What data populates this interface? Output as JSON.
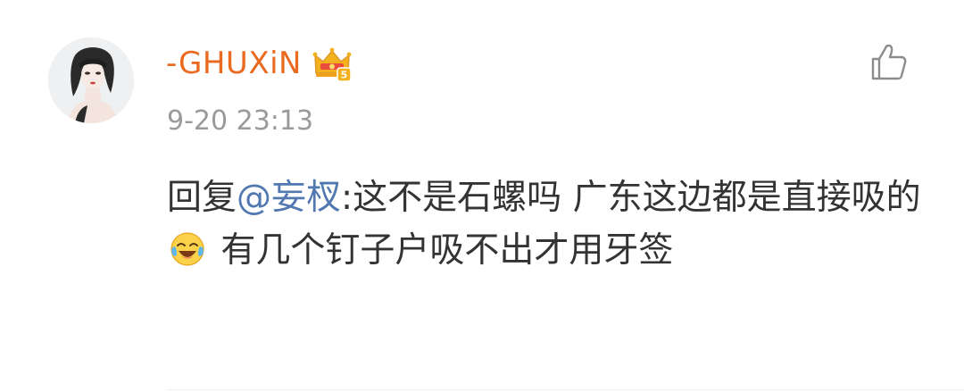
{
  "comment": {
    "username": "-GHUXiN",
    "badge_level": "5",
    "timestamp": "9-20 23:13",
    "content": {
      "reply_prefix": "回复",
      "mention": "@妄杈",
      "text_before_emoji": ":这不是石螺吗 广东这边都是直接吸的",
      "emoji": "laugh-cry-emoji",
      "text_after_emoji": " 有几个钉子户吸不出才用牙签"
    }
  },
  "colors": {
    "username": "#ea6a1f",
    "mention": "#5278b1",
    "body_text": "#333333",
    "timestamp": "#9a9a9a",
    "badge_gold": "#f3b21d",
    "badge_red": "#e94b3c"
  },
  "icons": {
    "like": "thumbs-up-icon",
    "badge": "crown-vip-badge-icon"
  }
}
